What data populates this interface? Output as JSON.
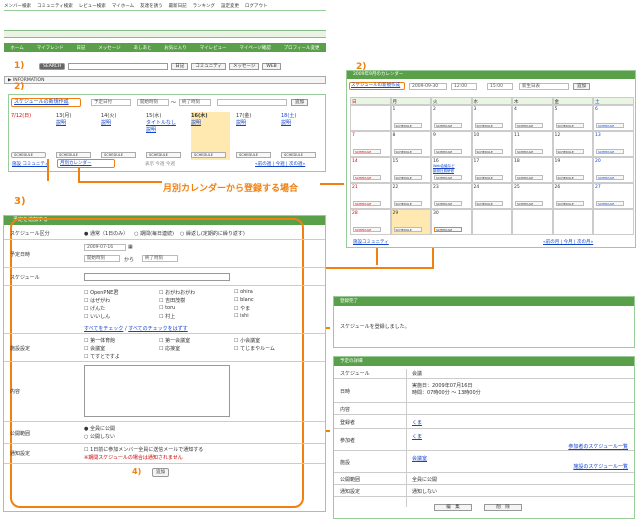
{
  "global_nav": [
    "メンバー検索",
    "コミュニティ検索",
    "レビュー検索",
    "マイホーム",
    "友達を誘う",
    "最新日記",
    "ランキング",
    "設定変更",
    "ログアウト"
  ],
  "menu": [
    "ホーム",
    "マイフレンド",
    "日記",
    "メッセージ",
    "あしあと",
    "お気に入り",
    "マイレビュー",
    "マイページ確認",
    "プロフィール変更"
  ],
  "steps": {
    "s1": "1)",
    "s2": "2)",
    "s2b": "2)",
    "s3": "3)",
    "s4": "4)"
  },
  "search": {
    "button": "SEARCH",
    "tabs": [
      "日記",
      "コミュニティ",
      "メッセージ",
      "WEB"
    ]
  },
  "info_label": "▶ INFORMATION",
  "schedule_box": {
    "new_link": "スケジュールの新規作成",
    "title_ph": "予定日付",
    "start_ph": "開始時刻",
    "tilde": "～",
    "end_ph": "終了時刻",
    "add": "追加",
    "days": [
      {
        "d": "7/12(日)",
        "items": [],
        "red": true
      },
      {
        "d": "13(月)",
        "items": [
          "説明"
        ]
      },
      {
        "d": "14(火)",
        "items": [
          "説明"
        ]
      },
      {
        "d": "15(水)",
        "items": [
          "タイトルなし",
          "説明"
        ]
      },
      {
        "d": "16(木)",
        "items": [
          "説明"
        ],
        "hl": true
      },
      {
        "d": "17(金)",
        "items": [
          "説明"
        ]
      },
      {
        "d": "18(土)",
        "items": [
          "説明"
        ],
        "blue": true
      }
    ],
    "sched_btn": "SCHEDULE",
    "footer_left": "施設 コミュニティ",
    "month_cal": "月別カレンダー",
    "mid": "表示 今週 今週",
    "nav": "«前の週 | 今週 | 次の週»"
  },
  "callout": "月別カレンダーから登録する場合",
  "calendar": {
    "title": "2009年9月のカレンダー",
    "new_link": "スケジュールの新規作成",
    "date": "2009-09-30",
    "t1": "12:00",
    "t2": "15:00",
    "title_ph": "新生日表",
    "add": "追加",
    "weekdays": [
      "日",
      "月",
      "火",
      "水",
      "木",
      "金",
      "土"
    ],
    "rows": [
      [
        "",
        "1",
        "2",
        "3",
        "4",
        "5",
        "6"
      ],
      [
        "7",
        "8",
        "9",
        "10",
        "11",
        "12",
        "13"
      ],
      [
        "14",
        "15",
        "16",
        "17",
        "18",
        "19",
        "20"
      ],
      [
        "21",
        "22",
        "23",
        "24",
        "25",
        "26",
        "27"
      ],
      [
        "28",
        "29",
        "30",
        "",
        "",
        "",
        ""
      ]
    ],
    "note": "Web会議など\n新設社員研修",
    "footer_left": "施設コミュニティ",
    "footer_right": "«前の月 | 今月 | 次の月»"
  },
  "form": {
    "title": "予定を追加する",
    "label_type": "スケジュール区分",
    "type_opts": [
      "通常（1日のみ）",
      "期間(毎日連続)",
      "繰返し(定期的に繰り返す)"
    ],
    "label_date": "予定日時",
    "date_val": "2009-07-16",
    "start_ph": "開始時刻",
    "kara": "から",
    "end_ph": "終了時刻",
    "label_sched": "スケジュール",
    "label_member": "",
    "members": [
      "OpenPNE君",
      "おがわおがわ",
      "ohira",
      "はぜがわ",
      "吉田茂樹",
      "blanc",
      "げんた",
      "toru",
      "やま",
      "いいしん",
      "村上",
      "ishi"
    ],
    "check_all": "すべてをチェック",
    "uncheck_all": "すべてのチェックをはずす",
    "label_facility": "施設設定",
    "facilities": [
      "第一体育館",
      "第一会議室",
      "小会議室",
      "会議室",
      "応接室",
      "てじまやルーム",
      "てすとですよ"
    ],
    "label_content": "内容",
    "label_public": "公開範囲",
    "public_opts": [
      "全員に公開",
      "公開しない"
    ],
    "label_notify": "通知設定",
    "notify_text": "1日前に参加メンバー全員に送信メールで通知する",
    "notify_note": "※期間スケジュールの場合は通知されません",
    "submit": "追加"
  },
  "done": {
    "title": "登録完了",
    "message": "スケジュールを登録しました。"
  },
  "detail": {
    "title": "予定の詳細",
    "rows": [
      {
        "k": "スケジュール",
        "v": "会議"
      },
      {
        "k": "日時",
        "v": "実施日：2009年07月16日\n時間：07時00分 ～ 13時00分"
      },
      {
        "k": "内容",
        "v": ""
      },
      {
        "k": "登録者",
        "v": "くま"
      },
      {
        "k": "参加者",
        "v": "くま",
        "r": "参加者のスケジュール一覧"
      },
      {
        "k": "施設",
        "v": "会議室",
        "r": "施設のスケジュール一覧"
      },
      {
        "k": "公開範囲",
        "v": "全員に公開"
      },
      {
        "k": "通知設定",
        "v": "通知しない"
      }
    ],
    "edit": "編　集",
    "del": "削　除"
  },
  "colors": {
    "accent": "#f08010",
    "green": "#5aa04a"
  }
}
